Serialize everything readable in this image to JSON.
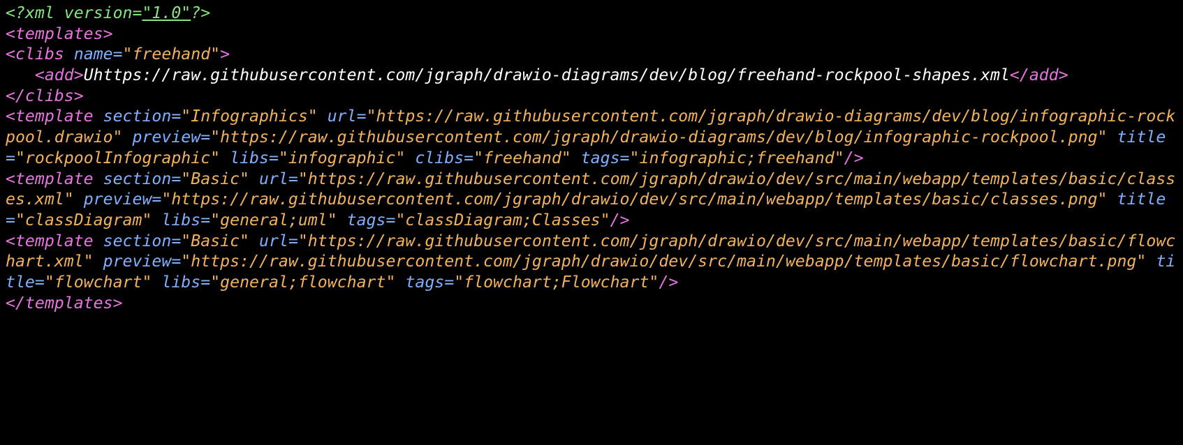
{
  "xml_decl": {
    "open": "<?xml",
    "version_attr": "version=",
    "version_val": "\"1.0\"",
    "close": "?>"
  },
  "root_open": "<templates>",
  "root_close": "</templates>",
  "clibs": {
    "open_tag": "<clibs",
    "name_attr": "name=",
    "name_val": "\"freehand\"",
    "open_tag_end": ">",
    "add_open": "<add>",
    "add_text": "Uhttps://raw.githubusercontent.com/jgraph/drawio-diagrams/dev/blog/freehand-rockpool-shapes.xml",
    "add_close": "</add>",
    "close": "</clibs>"
  },
  "templates": [
    {
      "tag_open": "<template",
      "section_attr": "section=",
      "section_val": "\"Infographics\"",
      "url_attr": "url=",
      "url_val": "\"https://raw.githubusercontent.com/jgraph/drawio-diagrams/dev/blog/infographic-rockpool.drawio\"",
      "preview_attr": "preview=",
      "preview_val": "\"https://raw.githubusercontent.com/jgraph/drawio-diagrams/dev/blog/infographic-rockpool.png\"",
      "title_attr": "title=",
      "title_val": "\"rockpoolInfographic\"",
      "libs_attr": "libs=",
      "libs_val": "\"infographic\"",
      "clibs_attr": "clibs=",
      "clibs_val": "\"freehand\"",
      "tags_attr": "tags=",
      "tags_val": "\"infographic;freehand\"",
      "tag_close": "/>"
    },
    {
      "tag_open": "<template",
      "section_attr": "section=",
      "section_val": "\"Basic\"",
      "url_attr": "url=",
      "url_val": "\"https://raw.githubusercontent.com/jgraph/drawio/dev/src/main/webapp/templates/basic/classes.xml\"",
      "preview_attr": "preview=",
      "preview_val": "\"https://raw.githubusercontent.com/jgraph/drawio/dev/src/main/webapp/templates/basic/classes.png\"",
      "title_attr": "title=",
      "title_val": "\"classDiagram\"",
      "libs_attr": "libs=",
      "libs_val": "\"general;uml\"",
      "clibs_attr": null,
      "clibs_val": null,
      "tags_attr": "tags=",
      "tags_val": "\"classDiagram;Classes\"",
      "tag_close": "/>"
    },
    {
      "tag_open": "<template",
      "section_attr": "section=",
      "section_val": "\"Basic\"",
      "url_attr": "url=",
      "url_val": "\"https://raw.githubusercontent.com/jgraph/drawio/dev/src/main/webapp/templates/basic/flowchart.xml\"",
      "preview_attr": "preview=",
      "preview_val": "\"https://raw.githubusercontent.com/jgraph/drawio/dev/src/main/webapp/templates/basic/flowchart.png\"",
      "title_attr": "title=",
      "title_val": "\"flowchart\"",
      "libs_attr": "libs=",
      "libs_val": "\"general;flowchart\"",
      "clibs_attr": null,
      "clibs_val": null,
      "tags_attr": "tags=",
      "tags_val": "\"flowchart;Flowchart\"",
      "tag_close": "/>"
    }
  ]
}
